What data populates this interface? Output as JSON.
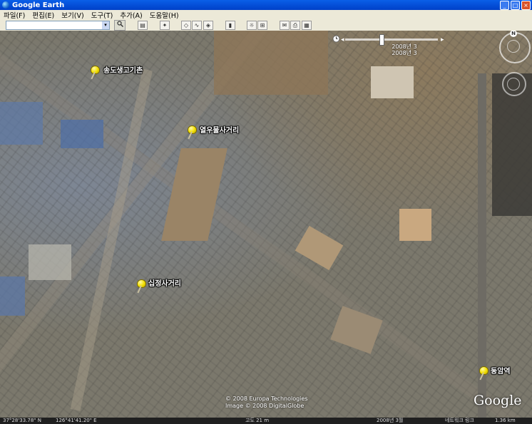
{
  "window": {
    "title": "Google Earth",
    "min_glyph": "_",
    "max_glyph": "□",
    "close_glyph": "×"
  },
  "menu": {
    "items": [
      "파일(F)",
      "편집(E)",
      "보기(V)",
      "도구(T)",
      "추가(A)",
      "도움말(H)"
    ]
  },
  "toolbar": {
    "search": {
      "value": "",
      "arrow": "▾"
    },
    "search_button_icon": "search-icon",
    "buttons": [
      {
        "icon": "sidebar-icon",
        "glyph": "▤"
      },
      {
        "icon": "placemark-add-icon",
        "glyph": "✦"
      },
      {
        "icon": "polygon-icon",
        "glyph": "◇"
      },
      {
        "icon": "path-icon",
        "glyph": "∿"
      },
      {
        "icon": "overlay-icon",
        "glyph": "◈"
      },
      {
        "icon": "ruler-icon",
        "glyph": "▮"
      },
      {
        "icon": "sunlight-icon",
        "glyph": "☼"
      },
      {
        "icon": "sky-icon",
        "glyph": "⊞"
      },
      {
        "icon": "email-icon",
        "glyph": "✉"
      },
      {
        "icon": "print-icon",
        "glyph": "⎙"
      },
      {
        "icon": "map-view-icon",
        "glyph": "▦"
      }
    ]
  },
  "time_slider": {
    "date_line1": "2008년 3",
    "date_line2": "2008년 3",
    "prev": "◂",
    "next": "▸",
    "clock_icon": "clock-icon"
  },
  "placemarks": [
    {
      "label": "송도생고기촌"
    },
    {
      "label": "열우물사거리"
    },
    {
      "label": "십정사거리"
    },
    {
      "label": "동암역"
    }
  ],
  "navigation": {
    "north": "N"
  },
  "copyright": {
    "line1": "© 2008 Europa Technologies",
    "line2": "Image © 2008 DigitalGlobe"
  },
  "logo": "Google",
  "status": {
    "lat": "37°28'33.78\" N",
    "lon": "126°41'41.20\" E",
    "elev": "고도 21 m",
    "imagery_date": "2008년 3월",
    "stream": "네트워크 링크",
    "eye_alt": "1.36 km"
  },
  "colors": {
    "title_bar": "#0a5fe8",
    "pin": "#f2e000",
    "chrome": "#ece9d8"
  }
}
